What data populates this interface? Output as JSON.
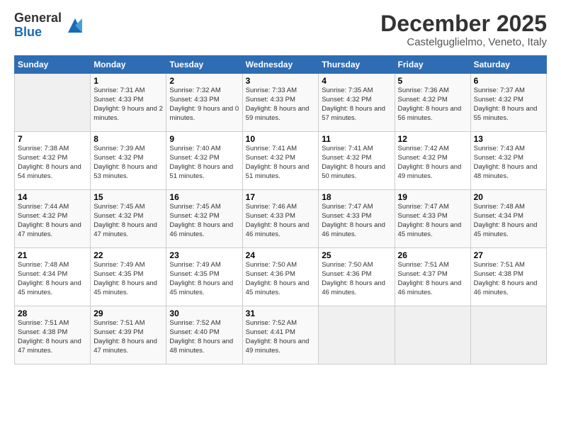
{
  "logo": {
    "general": "General",
    "blue": "Blue"
  },
  "header": {
    "month": "December 2025",
    "location": "Castelguglielmo, Veneto, Italy"
  },
  "weekdays": [
    "Sunday",
    "Monday",
    "Tuesday",
    "Wednesday",
    "Thursday",
    "Friday",
    "Saturday"
  ],
  "weeks": [
    [
      {
        "day": "",
        "sunrise": "",
        "sunset": "",
        "daylight": ""
      },
      {
        "day": "1",
        "sunrise": "Sunrise: 7:31 AM",
        "sunset": "Sunset: 4:33 PM",
        "daylight": "Daylight: 9 hours and 2 minutes."
      },
      {
        "day": "2",
        "sunrise": "Sunrise: 7:32 AM",
        "sunset": "Sunset: 4:33 PM",
        "daylight": "Daylight: 9 hours and 0 minutes."
      },
      {
        "day": "3",
        "sunrise": "Sunrise: 7:33 AM",
        "sunset": "Sunset: 4:33 PM",
        "daylight": "Daylight: 8 hours and 59 minutes."
      },
      {
        "day": "4",
        "sunrise": "Sunrise: 7:35 AM",
        "sunset": "Sunset: 4:32 PM",
        "daylight": "Daylight: 8 hours and 57 minutes."
      },
      {
        "day": "5",
        "sunrise": "Sunrise: 7:36 AM",
        "sunset": "Sunset: 4:32 PM",
        "daylight": "Daylight: 8 hours and 56 minutes."
      },
      {
        "day": "6",
        "sunrise": "Sunrise: 7:37 AM",
        "sunset": "Sunset: 4:32 PM",
        "daylight": "Daylight: 8 hours and 55 minutes."
      }
    ],
    [
      {
        "day": "7",
        "sunrise": "Sunrise: 7:38 AM",
        "sunset": "Sunset: 4:32 PM",
        "daylight": "Daylight: 8 hours and 54 minutes."
      },
      {
        "day": "8",
        "sunrise": "Sunrise: 7:39 AM",
        "sunset": "Sunset: 4:32 PM",
        "daylight": "Daylight: 8 hours and 53 minutes."
      },
      {
        "day": "9",
        "sunrise": "Sunrise: 7:40 AM",
        "sunset": "Sunset: 4:32 PM",
        "daylight": "Daylight: 8 hours and 51 minutes."
      },
      {
        "day": "10",
        "sunrise": "Sunrise: 7:41 AM",
        "sunset": "Sunset: 4:32 PM",
        "daylight": "Daylight: 8 hours and 51 minutes."
      },
      {
        "day": "11",
        "sunrise": "Sunrise: 7:41 AM",
        "sunset": "Sunset: 4:32 PM",
        "daylight": "Daylight: 8 hours and 50 minutes."
      },
      {
        "day": "12",
        "sunrise": "Sunrise: 7:42 AM",
        "sunset": "Sunset: 4:32 PM",
        "daylight": "Daylight: 8 hours and 49 minutes."
      },
      {
        "day": "13",
        "sunrise": "Sunrise: 7:43 AM",
        "sunset": "Sunset: 4:32 PM",
        "daylight": "Daylight: 8 hours and 48 minutes."
      }
    ],
    [
      {
        "day": "14",
        "sunrise": "Sunrise: 7:44 AM",
        "sunset": "Sunset: 4:32 PM",
        "daylight": "Daylight: 8 hours and 47 minutes."
      },
      {
        "day": "15",
        "sunrise": "Sunrise: 7:45 AM",
        "sunset": "Sunset: 4:32 PM",
        "daylight": "Daylight: 8 hours and 47 minutes."
      },
      {
        "day": "16",
        "sunrise": "Sunrise: 7:45 AM",
        "sunset": "Sunset: 4:32 PM",
        "daylight": "Daylight: 8 hours and 46 minutes."
      },
      {
        "day": "17",
        "sunrise": "Sunrise: 7:46 AM",
        "sunset": "Sunset: 4:33 PM",
        "daylight": "Daylight: 8 hours and 46 minutes."
      },
      {
        "day": "18",
        "sunrise": "Sunrise: 7:47 AM",
        "sunset": "Sunset: 4:33 PM",
        "daylight": "Daylight: 8 hours and 46 minutes."
      },
      {
        "day": "19",
        "sunrise": "Sunrise: 7:47 AM",
        "sunset": "Sunset: 4:33 PM",
        "daylight": "Daylight: 8 hours and 45 minutes."
      },
      {
        "day": "20",
        "sunrise": "Sunrise: 7:48 AM",
        "sunset": "Sunset: 4:34 PM",
        "daylight": "Daylight: 8 hours and 45 minutes."
      }
    ],
    [
      {
        "day": "21",
        "sunrise": "Sunrise: 7:48 AM",
        "sunset": "Sunset: 4:34 PM",
        "daylight": "Daylight: 8 hours and 45 minutes."
      },
      {
        "day": "22",
        "sunrise": "Sunrise: 7:49 AM",
        "sunset": "Sunset: 4:35 PM",
        "daylight": "Daylight: 8 hours and 45 minutes."
      },
      {
        "day": "23",
        "sunrise": "Sunrise: 7:49 AM",
        "sunset": "Sunset: 4:35 PM",
        "daylight": "Daylight: 8 hours and 45 minutes."
      },
      {
        "day": "24",
        "sunrise": "Sunrise: 7:50 AM",
        "sunset": "Sunset: 4:36 PM",
        "daylight": "Daylight: 8 hours and 45 minutes."
      },
      {
        "day": "25",
        "sunrise": "Sunrise: 7:50 AM",
        "sunset": "Sunset: 4:36 PM",
        "daylight": "Daylight: 8 hours and 46 minutes."
      },
      {
        "day": "26",
        "sunrise": "Sunrise: 7:51 AM",
        "sunset": "Sunset: 4:37 PM",
        "daylight": "Daylight: 8 hours and 46 minutes."
      },
      {
        "day": "27",
        "sunrise": "Sunrise: 7:51 AM",
        "sunset": "Sunset: 4:38 PM",
        "daylight": "Daylight: 8 hours and 46 minutes."
      }
    ],
    [
      {
        "day": "28",
        "sunrise": "Sunrise: 7:51 AM",
        "sunset": "Sunset: 4:38 PM",
        "daylight": "Daylight: 8 hours and 47 minutes."
      },
      {
        "day": "29",
        "sunrise": "Sunrise: 7:51 AM",
        "sunset": "Sunset: 4:39 PM",
        "daylight": "Daylight: 8 hours and 47 minutes."
      },
      {
        "day": "30",
        "sunrise": "Sunrise: 7:52 AM",
        "sunset": "Sunset: 4:40 PM",
        "daylight": "Daylight: 8 hours and 48 minutes."
      },
      {
        "day": "31",
        "sunrise": "Sunrise: 7:52 AM",
        "sunset": "Sunset: 4:41 PM",
        "daylight": "Daylight: 8 hours and 49 minutes."
      },
      {
        "day": "",
        "sunrise": "",
        "sunset": "",
        "daylight": ""
      },
      {
        "day": "",
        "sunrise": "",
        "sunset": "",
        "daylight": ""
      },
      {
        "day": "",
        "sunrise": "",
        "sunset": "",
        "daylight": ""
      }
    ]
  ]
}
